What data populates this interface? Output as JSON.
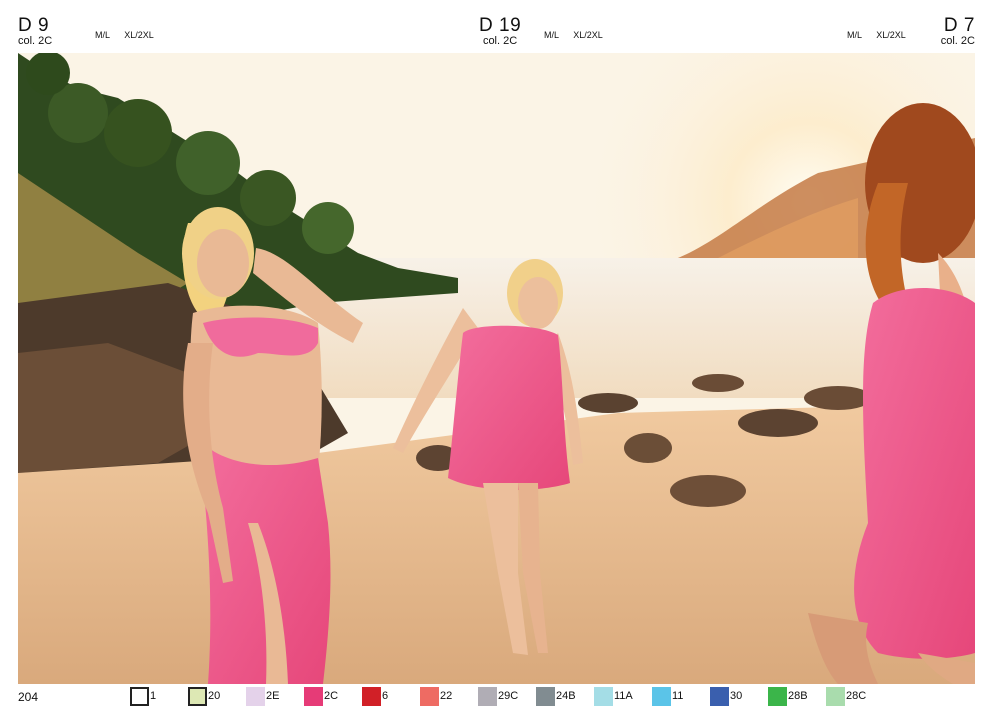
{
  "products": {
    "left": {
      "code": "D 9",
      "color": "col. 2C",
      "size_a": "M/L",
      "size_b": "XL/2XL"
    },
    "center": {
      "code": "D 19",
      "color": "col. 2C",
      "size_a": "M/L",
      "size_b": "XL/2XL"
    },
    "right": {
      "code": "D 7",
      "color": "col. 2C",
      "size_a": "M/L",
      "size_b": "XL/2XL"
    }
  },
  "page_number": "204",
  "swatches": [
    {
      "code": "1",
      "color": "#ffffff"
    },
    {
      "code": "20",
      "color": "#dde8b4"
    },
    {
      "code": "2E",
      "color": "#e4d2ea"
    },
    {
      "code": "2C",
      "color": "#e63b77"
    },
    {
      "code": "6",
      "color": "#d12027"
    },
    {
      "code": "22",
      "color": "#ee6b63"
    },
    {
      "code": "29C",
      "color": "#b0adb5"
    },
    {
      "code": "24B",
      "color": "#818c91"
    },
    {
      "code": "11A",
      "color": "#a4dde6"
    },
    {
      "code": "11",
      "color": "#5bc4e8"
    },
    {
      "code": "30",
      "color": "#3a5fae"
    },
    {
      "code": "28B",
      "color": "#3bb54a"
    },
    {
      "code": "28C",
      "color": "#a9dcad"
    }
  ]
}
